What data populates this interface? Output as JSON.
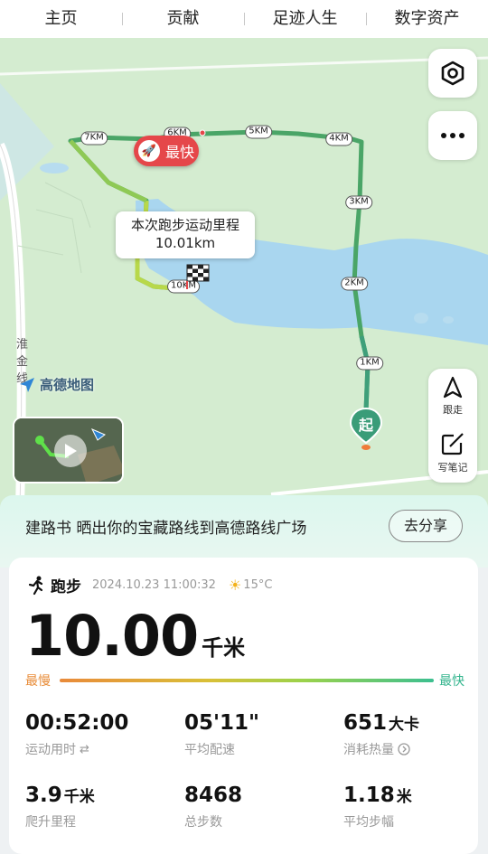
{
  "tabs": [
    "主页",
    "贡献",
    "足迹人生",
    "数字资产"
  ],
  "map": {
    "km_markers": [
      "7KM",
      "6KM",
      "5KM",
      "4KM",
      "3KM",
      "2KM",
      "1KM",
      "10KM"
    ],
    "fastest_label": "最快",
    "callout_title": "本次跑步运动里程",
    "callout_distance": "10.01km",
    "start_label": "起",
    "place_name": "淮金线",
    "brand": "高德地图",
    "tools": {
      "follow_label": "跟走",
      "note_label": "写笔记"
    },
    "route_colors": {
      "slow": "#e0c23a",
      "mid": "#9ad04a",
      "fast": "#3fa36a"
    }
  },
  "banner": {
    "text": "建路书 晒出你的宝藏路线到高德路线广场",
    "share_button": "去分享"
  },
  "activity": {
    "type": "跑步",
    "datetime": "2024.10.23 11:00:32",
    "temperature": "15°C",
    "distance": "10.00",
    "distance_unit": "千米",
    "pace_slow_label": "最慢",
    "pace_fast_label": "最快"
  },
  "stats": [
    {
      "value": "00:52:00",
      "unit": "",
      "label": "运动用时",
      "icon": "swap-icon"
    },
    {
      "value": "05'11\"",
      "unit": "",
      "label": "平均配速",
      "icon": ""
    },
    {
      "value": "651",
      "unit": "大卡",
      "label": "消耗热量",
      "icon": "info-arrow-icon"
    },
    {
      "value": "3.9",
      "unit": "千米",
      "label": "爬升里程",
      "icon": ""
    },
    {
      "value": "8468",
      "unit": "",
      "label": "总步数",
      "icon": ""
    },
    {
      "value": "1.18",
      "unit": "米",
      "label": "平均步幅",
      "icon": ""
    }
  ]
}
